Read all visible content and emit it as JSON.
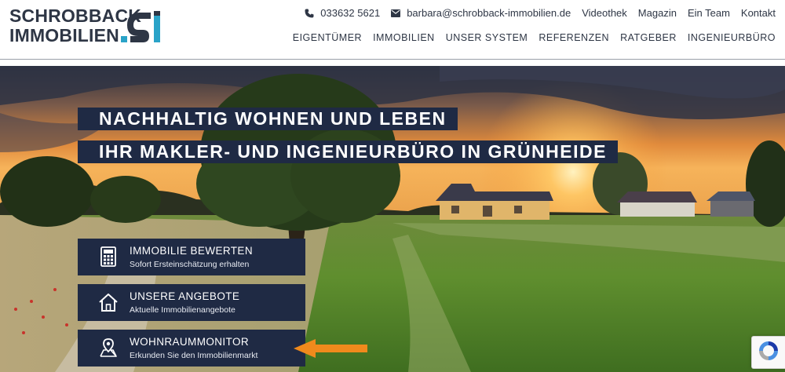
{
  "header": {
    "logo_line1": "SCHROBBACK",
    "logo_line2": "IMMOBILIEN",
    "phone": "033632 5621",
    "email": "barbara@schrobback-immobilien.de",
    "top_links": [
      "Videothek",
      "Magazin",
      "Ein Team",
      "Kontakt"
    ],
    "nav": [
      "EIGENTÜMER",
      "IMMOBILIEN",
      "UNSER SYSTEM",
      "REFERENZEN",
      "RATGEBER",
      "INGENIEURBÜRO"
    ]
  },
  "hero": {
    "headline1": "NACHHALTIG WOHNEN UND LEBEN",
    "headline2": "IHR MAKLER- UND INGENIEURBÜRO IN GRÜNHEIDE"
  },
  "cards": [
    {
      "title": "IMMOBILIE BEWERTEN",
      "subtitle": "Sofort Ersteinschätzung erhalten",
      "icon": "calculator-icon"
    },
    {
      "title": "UNSERE ANGEBOTE",
      "subtitle": "Aktuelle Immobilienangebote",
      "icon": "house-icon"
    },
    {
      "title": "WOHNRAUMMONITOR",
      "subtitle": "Erkunden Sie den Immobilienmarkt",
      "icon": "map-pin-icon"
    }
  ],
  "colors": {
    "navy": "#1f2a44",
    "logo_accent": "#2aa3c8",
    "arrow": "#f08a1c"
  }
}
